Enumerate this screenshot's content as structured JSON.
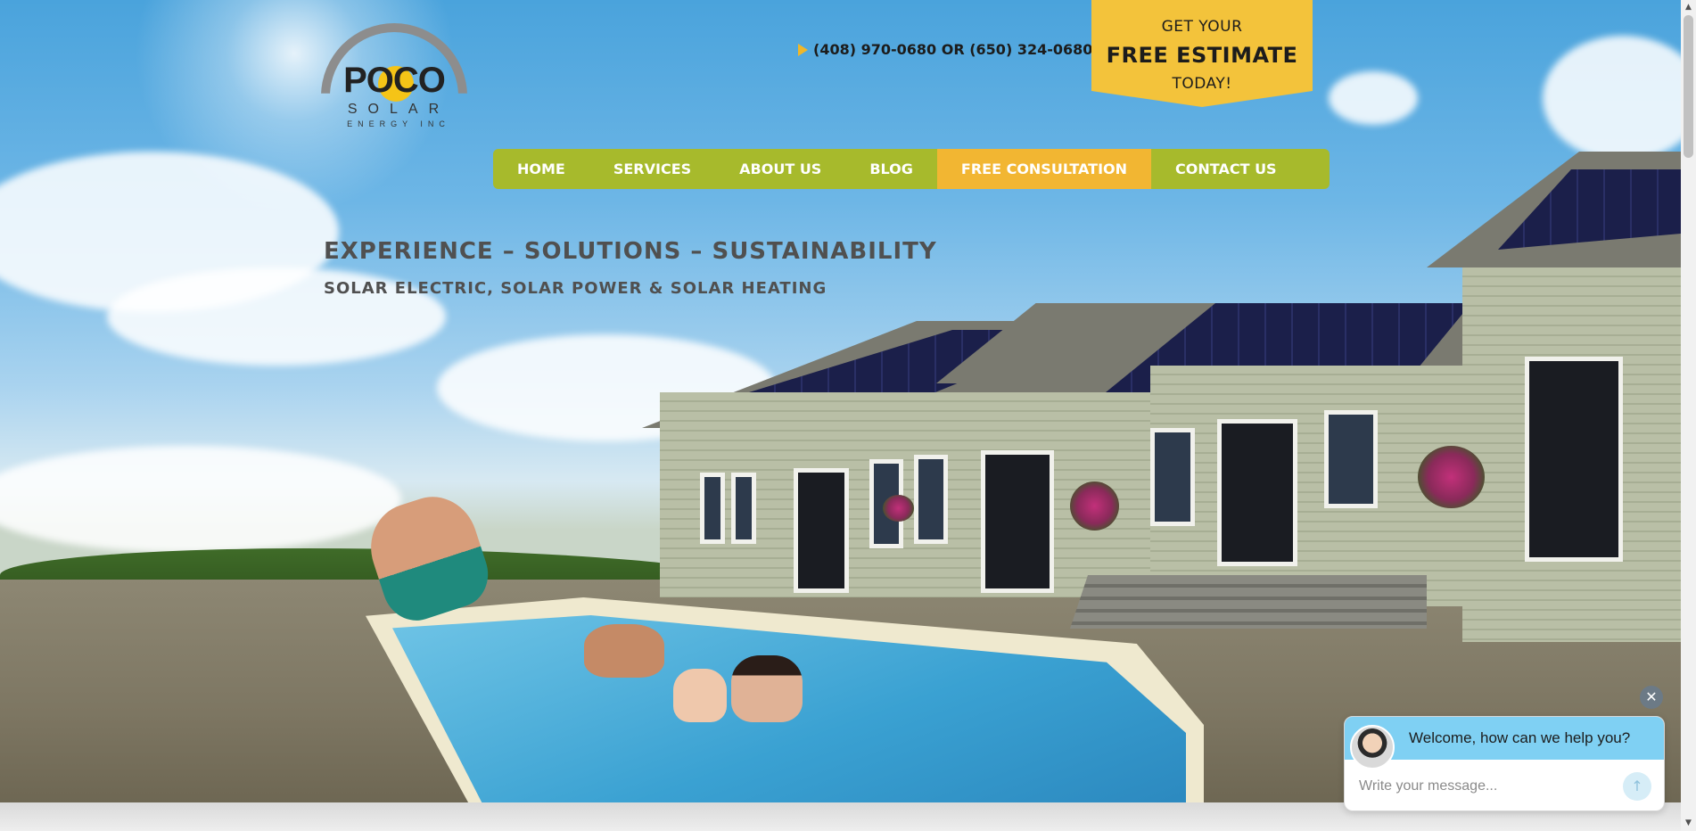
{
  "header": {
    "logo": {
      "name": "POCO",
      "line2": "SOLAR",
      "line3": "ENERGY INC"
    },
    "phone": "(408) 970-0680 OR (650) 324-0680",
    "estimate": {
      "line1": "GET YOUR",
      "line2": "FREE ESTIMATE",
      "line3": "TODAY!"
    }
  },
  "nav": {
    "items": [
      {
        "label": "HOME"
      },
      {
        "label": "SERVICES"
      },
      {
        "label": "ABOUT US"
      },
      {
        "label": "BLOG"
      },
      {
        "label": "FREE CONSULTATION",
        "active": true
      },
      {
        "label": "CONTACT US"
      }
    ]
  },
  "hero": {
    "tagline": "EXPERIENCE – SOLUTIONS – SUSTAINABILITY",
    "subtagline": "SOLAR ELECTRIC, SOLAR POWER & SOLAR HEATING"
  },
  "chat": {
    "welcome": "Welcome, how can we help you?",
    "placeholder": "Write your message...",
    "close_icon": "close-icon",
    "send_icon": "arrow-up-icon"
  },
  "colors": {
    "nav_green": "#a7ba2c",
    "nav_active": "#f2b632",
    "estimate_yellow": "#f3c33b",
    "chat_header": "#7fd0f3",
    "text_gray": "#505050"
  }
}
